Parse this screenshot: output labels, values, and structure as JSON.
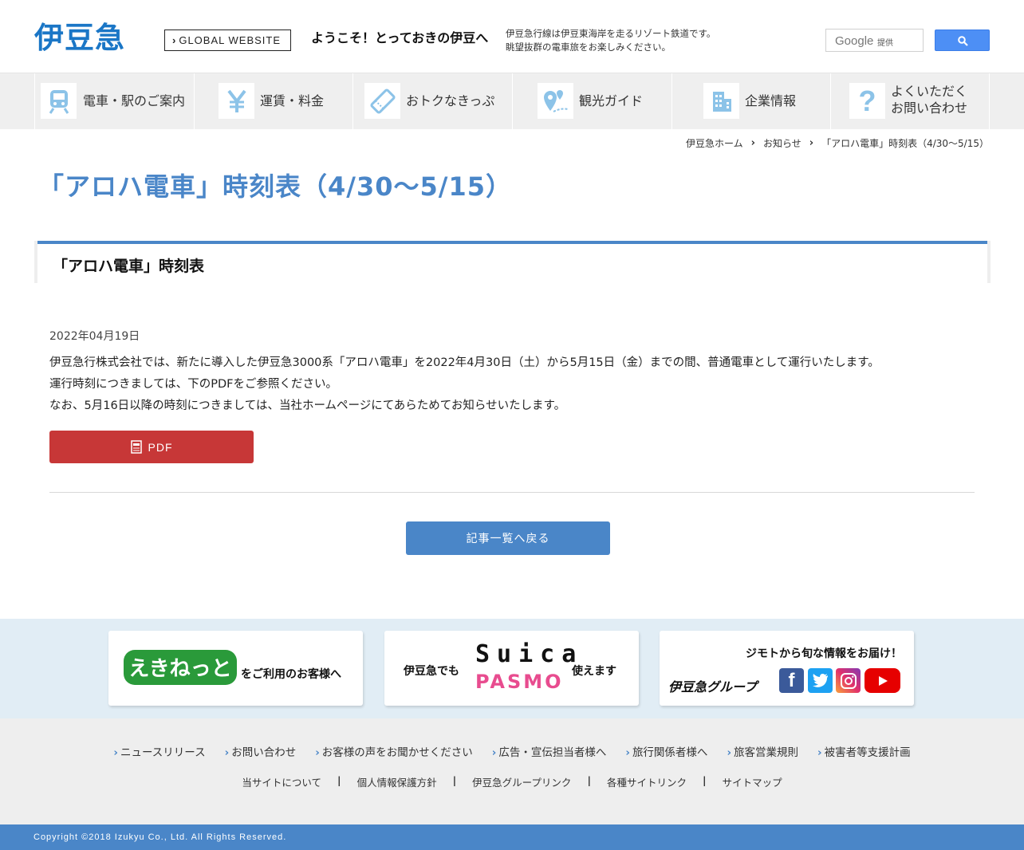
{
  "header": {
    "logo": "伊豆急",
    "global_btn": "GLOBAL WEBSITE",
    "welcome": "ようこそ！とっておきの伊豆へ",
    "tagline_1": "伊豆急行線は伊豆東海岸を走るリゾート鉄道です。",
    "tagline_2": "眺望抜群の電車旅をお楽しみください。",
    "search_brand": "Google",
    "search_provided": "提供"
  },
  "nav": {
    "items": [
      {
        "label": "電車・駅のご案内",
        "icon": "train-icon"
      },
      {
        "label": "運賃・料金",
        "icon": "yen-icon"
      },
      {
        "label": "おトクなきっぷ",
        "icon": "ticket-icon"
      },
      {
        "label": "観光ガイド",
        "icon": "map-pin-icon"
      },
      {
        "label": "企業情報",
        "icon": "building-icon"
      },
      {
        "label_1": "よくいただく",
        "label_2": "お問い合わせ",
        "icon": "question-icon"
      }
    ]
  },
  "breadcrumb": {
    "home": "伊豆急ホーム",
    "news": "お知らせ",
    "current": "「アロハ電車」時刻表（4/30～5/15）"
  },
  "article": {
    "title": "「アロハ電車」時刻表（4/30～5/15）",
    "section_title": "「アロハ電車」時刻表",
    "date": "2022年04月19日",
    "line_1": "伊豆急行株式会社では、新たに導入した伊豆急3000系「アロハ電車」を2022年4月30日（土）から5月15日（金）までの間、普通電車として運行いたします。",
    "line_2": "運行時刻につきましては、下のPDFをご参照ください。",
    "line_3": "なお、5月16日以降の時刻につきましては、当社ホームページにてあらためてお知らせいたします。",
    "pdf_label": "PDF",
    "back_label": "記事一覧へ戻る"
  },
  "banners": {
    "ekinet_logo": "えきねっと",
    "ekinet_text": "をご利用のお客様へ",
    "ic_left": "伊豆急でも",
    "ic_suica": "Suica",
    "ic_pasmo": "PASMO",
    "ic_right": "使えます",
    "sns_title": "ジモトから旬な情報をお届け！",
    "sns_group": "伊豆急グループ"
  },
  "footer": {
    "links_1": [
      "ニュースリリース",
      "お問い合わせ",
      "お客様の声をお聞かせください",
      "広告・宣伝担当者様へ",
      "旅行関係者様へ",
      "旅客営業規則",
      "被害者等支援計画"
    ],
    "links_2": [
      "当サイトについて",
      "個人情報保護方針",
      "伊豆急グループリンク",
      "各種サイトリンク",
      "サイトマップ"
    ],
    "copyright": "Copyright ©2018 Izukyu Co., Ltd. All Rights Reserved."
  },
  "colors": {
    "brand_blue": "#4a86c8",
    "logo_blue": "#1a76c6",
    "pdf_red": "#c73737",
    "search_blue": "#4d8ff5"
  }
}
